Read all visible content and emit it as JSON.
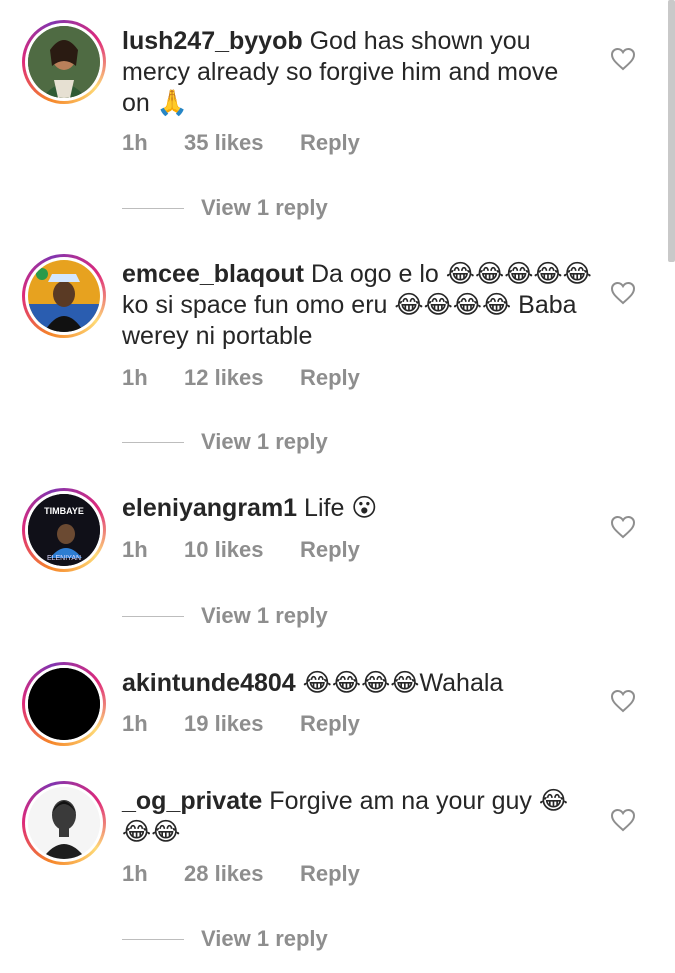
{
  "comments": [
    {
      "username": "lush247_byyob",
      "text": "God has shown you mercy already so forgive him and move on 🙏",
      "time": "1h",
      "likes": "35 likes",
      "reply": "Reply",
      "view_replies": "View 1 reply"
    },
    {
      "username": "emcee_blaqout",
      "text": "Da ogo e lo 😂😂😂😂😂 ko si space fun omo eru 😂😂😂😂 Baba werey ni portable",
      "time": "1h",
      "likes": "12 likes",
      "reply": "Reply",
      "view_replies": "View 1 reply"
    },
    {
      "username": "eleniyangram1",
      "text": "Life 😮",
      "time": "1h",
      "likes": "10 likes",
      "reply": "Reply",
      "view_replies": "View 1 reply"
    },
    {
      "username": "akintunde4804",
      "text": "😂😂😂😂Wahala",
      "time": "1h",
      "likes": "19 likes",
      "reply": "Reply"
    },
    {
      "username": "_og_private",
      "text": "Forgive am na your guy 😂😂😂",
      "time": "1h",
      "likes": "28 likes",
      "reply": "Reply",
      "view_replies": "View 1 reply"
    }
  ],
  "avatar_text": {
    "eleniyangram1_top": "TIMBAYE",
    "eleniyangram1_bottom": "ELENIYAN"
  },
  "colors": {
    "text": "#262626",
    "muted": "#8e8e8e",
    "ring_start": "#f58529",
    "ring_end": "#dd2a7b"
  },
  "icons": {
    "like": "heart-outline-icon"
  }
}
